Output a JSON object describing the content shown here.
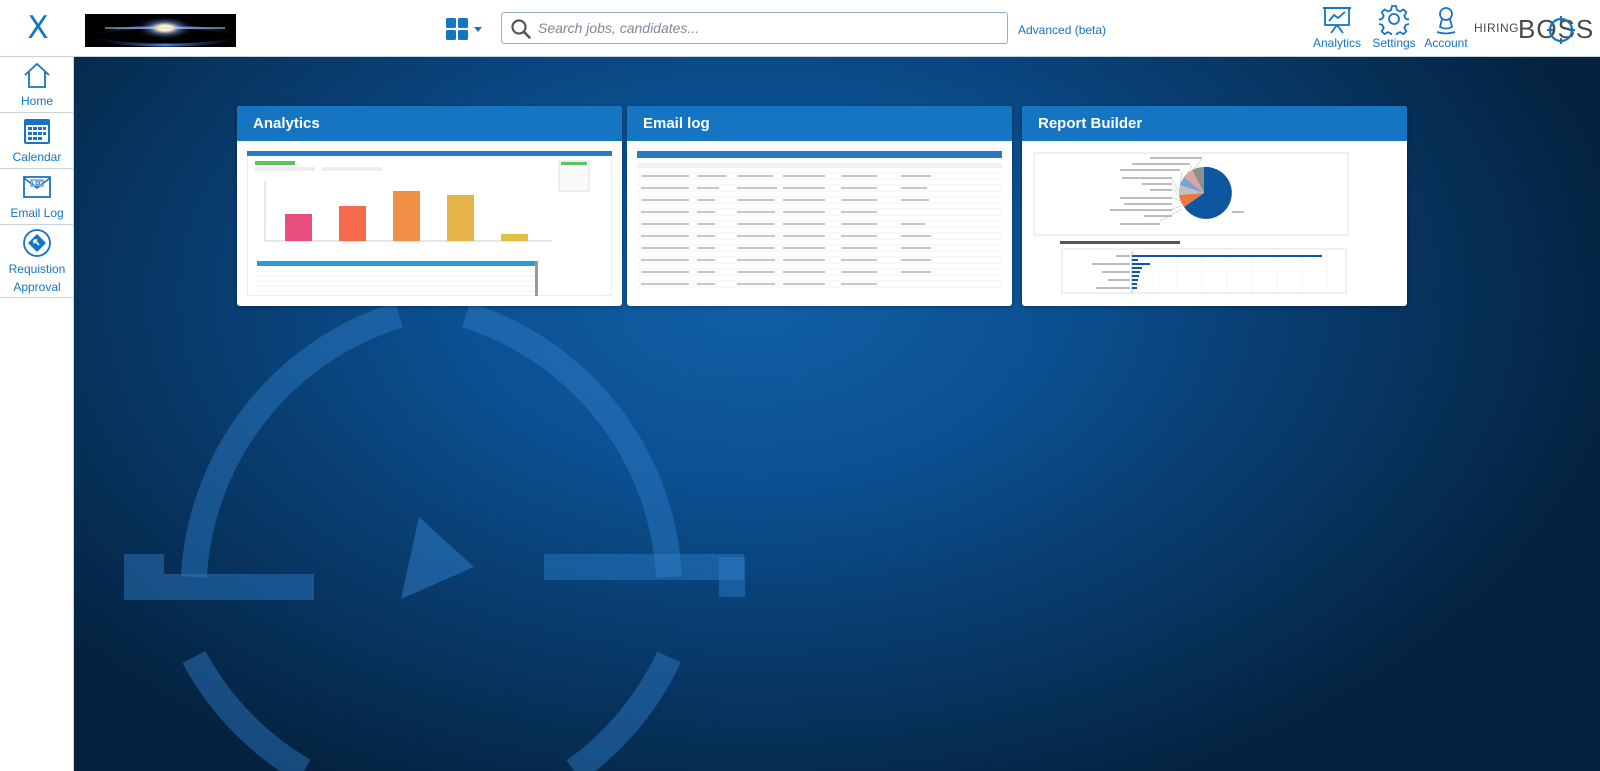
{
  "header": {
    "close_label": "X",
    "search": {
      "placeholder": "Search jobs, candidates...",
      "value": ""
    },
    "advanced_link": "Advanced (beta)",
    "nav": [
      {
        "label": "Analytics",
        "icon": "presentation-chart-icon"
      },
      {
        "label": "Settings",
        "icon": "gear-icon"
      },
      {
        "label": "Account",
        "icon": "user-icon"
      }
    ],
    "brand": {
      "prefix": "HIRING",
      "name": "BOSS"
    }
  },
  "sidebar": {
    "items": [
      {
        "label": "Home",
        "icon": "home-icon"
      },
      {
        "label": "Calendar",
        "icon": "calendar-icon"
      },
      {
        "label": "Email Log",
        "icon": "email-log-icon"
      },
      {
        "label": "Requistion Approval",
        "icon": "requisition-approval-icon"
      }
    ]
  },
  "cards": [
    {
      "title": "Analytics",
      "thumb": "analytics-preview"
    },
    {
      "title": "Email log",
      "thumb": "email-log-preview"
    },
    {
      "title": "Report Builder",
      "thumb": "report-builder-preview"
    }
  ],
  "colors": {
    "accent": "#1675c2",
    "card_header": "#1675c2",
    "background_center": "#1260a8",
    "background_edge": "#04213d"
  }
}
